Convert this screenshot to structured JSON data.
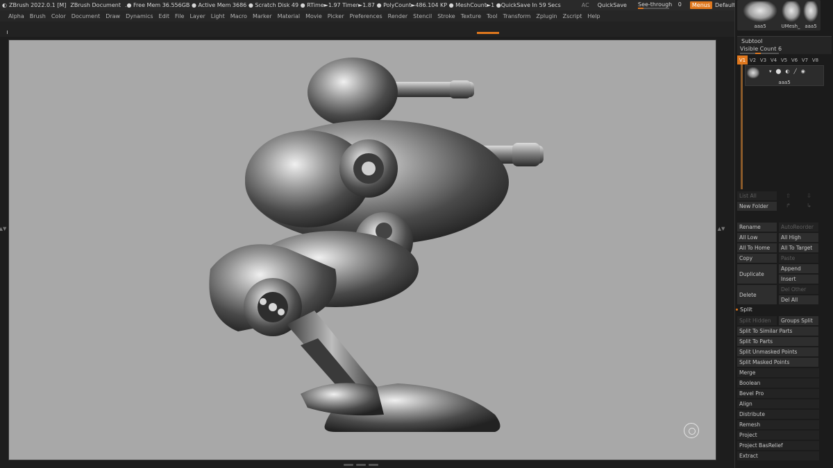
{
  "titlebar": {
    "app": "ZBrush 2022.0.1 [M]",
    "doc": "ZBrush Document",
    "stats": ".● Free Mem 36.556GB ● Active Mem 3686 ● Scratch Disk 49 ●  RTime►1.97 Timer►1.87 ● PolyCount►486.104 KP  ● MeshCount►1   ●QuickSave In 59 Secs",
    "ac": "AC",
    "quicksave": "QuickSave",
    "seethrough": "See-through",
    "seethrough_value": "0",
    "menus": "Menus",
    "script": "DefaultZScript"
  },
  "menubar": [
    "Alpha",
    "Brush",
    "Color",
    "Document",
    "Draw",
    "Dynamics",
    "Edit",
    "File",
    "Layer",
    "Light",
    "Macro",
    "Marker",
    "Material",
    "Movie",
    "Picker",
    "Preferences",
    "Render",
    "Stencil",
    "Stroke",
    "Texture",
    "Tool",
    "Transform",
    "Zplugin",
    "Zscript",
    "Help"
  ],
  "tool_thumbs": [
    {
      "label": "aaa5"
    },
    {
      "label": "UMesh_"
    },
    {
      "label": "aaa5"
    }
  ],
  "subtool": {
    "title": "Subtool",
    "visible_count": "Visible Count 6",
    "tabs": [
      "V1",
      "V2",
      "V3",
      "V4",
      "V5",
      "V6",
      "V7",
      "V8"
    ],
    "active_tab": "V1",
    "item_name": "aaa5"
  },
  "buttons": {
    "list_all": "List All",
    "new_folder": "New Folder",
    "rename": "Rename",
    "auto_reorder": "AutoReorder",
    "all_low": "All Low",
    "all_high": "All High",
    "all_to_home": "All To Home",
    "all_to_target": "All To Target",
    "copy": "Copy",
    "paste": "Paste",
    "duplicate": "Duplicate",
    "append": "Append",
    "insert": "Insert",
    "delete": "Delete",
    "del_other": "Del Other",
    "del_all": "Del All",
    "split": "Split",
    "split_hidden": "Split Hidden",
    "groups_split": "Groups Split",
    "split_similar": "Split To Similar Parts",
    "split_parts": "Split To Parts",
    "split_unmasked": "Split Unmasked Points",
    "split_masked": "Split Masked Points"
  },
  "sections": [
    "Merge",
    "Boolean",
    "Bevel Pro",
    "Align",
    "Distribute",
    "Remesh",
    "Project",
    "Project BasRelief",
    "Extract"
  ],
  "colors": {
    "accent": "#e0781e",
    "canvas": "#a8a8a8",
    "panel": "#1b1b1b"
  }
}
